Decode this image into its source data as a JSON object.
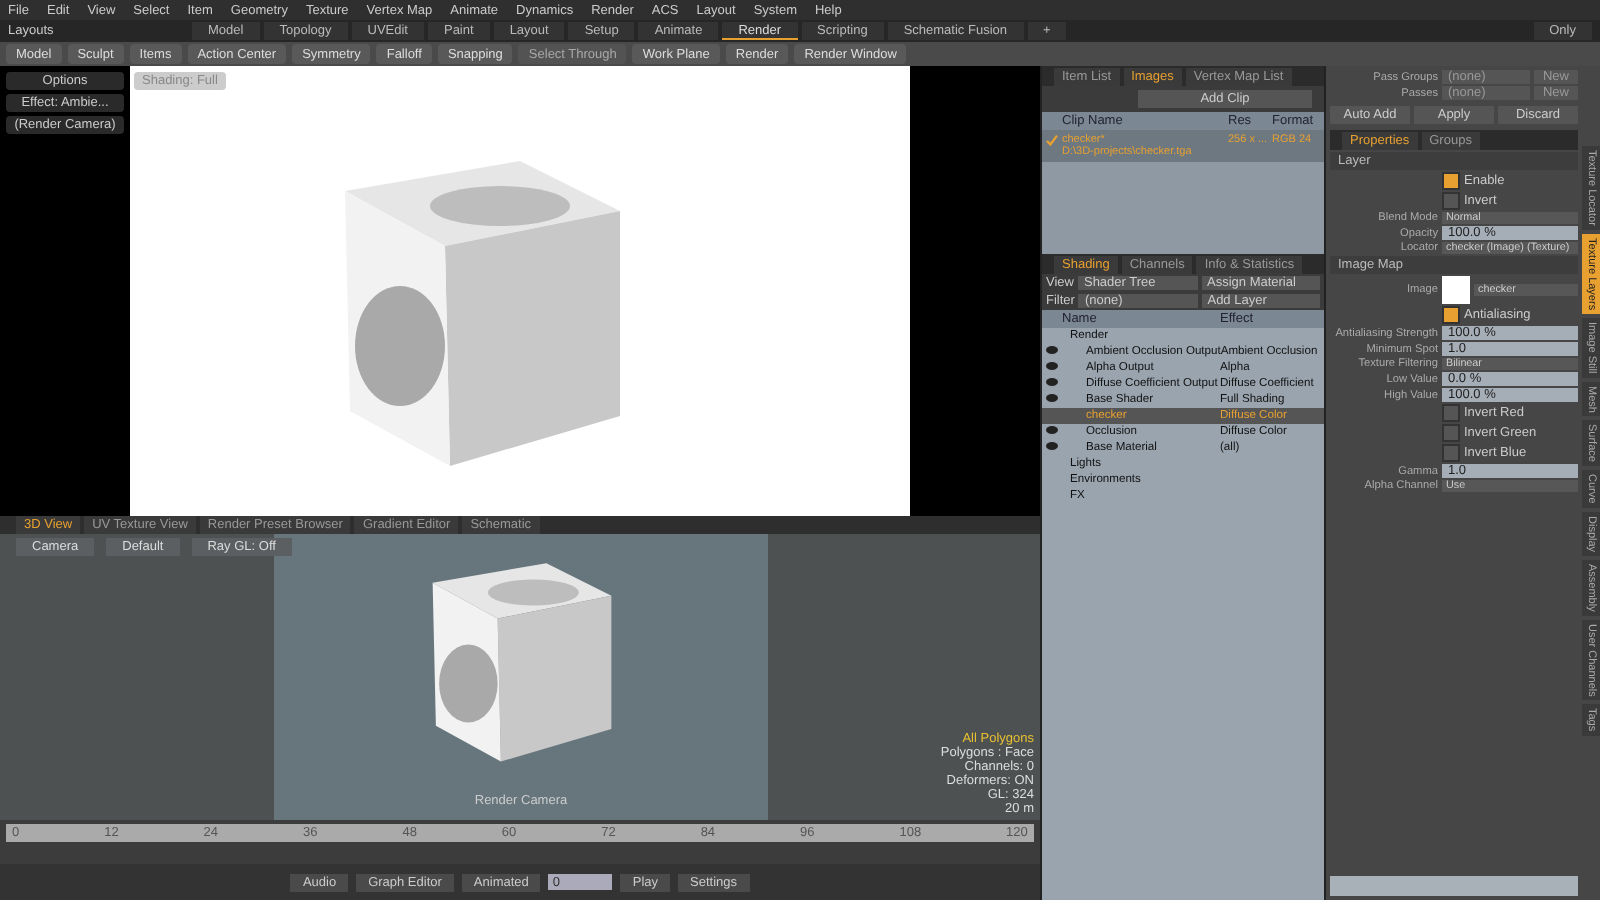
{
  "menu": [
    "File",
    "Edit",
    "View",
    "Select",
    "Item",
    "Geometry",
    "Texture",
    "Vertex Map",
    "Animate",
    "Dynamics",
    "Render",
    "ACS",
    "Layout",
    "System",
    "Help"
  ],
  "layouts_label": "Layouts",
  "layout_tabs": [
    {
      "label": "Model",
      "selected": false
    },
    {
      "label": "Topology",
      "selected": false
    },
    {
      "label": "UVEdit",
      "selected": false
    },
    {
      "label": "Paint",
      "selected": false
    },
    {
      "label": "Layout",
      "selected": false
    },
    {
      "label": "Setup",
      "selected": false
    },
    {
      "label": "Animate",
      "selected": false
    },
    {
      "label": "Render",
      "selected": true
    },
    {
      "label": "Scripting",
      "selected": false
    },
    {
      "label": "Schematic Fusion",
      "selected": false
    }
  ],
  "add_tab": "+",
  "only_toggle": "Only",
  "toolbar": [
    {
      "label": "Model",
      "disabled": false
    },
    {
      "label": "Sculpt",
      "disabled": false
    },
    {
      "label": "Items",
      "disabled": false
    },
    {
      "label": "Action Center",
      "disabled": false
    },
    {
      "label": "Symmetry",
      "disabled": false
    },
    {
      "label": "Falloff",
      "disabled": false
    },
    {
      "label": "Snapping",
      "disabled": false
    },
    {
      "label": "Select Through",
      "disabled": true
    },
    {
      "label": "Work Plane",
      "disabled": false
    },
    {
      "label": "Render",
      "disabled": false
    },
    {
      "label": "Render Window",
      "disabled": false
    }
  ],
  "render_view": {
    "options": "Options",
    "effect": "Effect: Ambie...",
    "camera": "(Render Camera)",
    "shading": "Shading: Full"
  },
  "clip_panel": {
    "tabs": [
      {
        "label": "Item List",
        "selected": false
      },
      {
        "label": "Images",
        "selected": true
      },
      {
        "label": "Vertex Map List",
        "selected": false
      }
    ],
    "add_clip": "Add Clip",
    "columns": [
      "Clip Name",
      "Res",
      "Format"
    ],
    "clips": [
      {
        "name": "checker*",
        "path": "D:\\3D-projects\\checker.tga",
        "res": "256 x ...",
        "format": "RGB 24",
        "checked": true
      }
    ]
  },
  "shading_panel": {
    "tabs": [
      {
        "label": "Shading",
        "selected": true
      },
      {
        "label": "Channels",
        "selected": false
      },
      {
        "label": "Info & Statistics",
        "selected": false
      }
    ],
    "view_label": "View",
    "view_value": "Shader Tree",
    "assign": "Assign Material",
    "filter_label": "Filter",
    "filter_value": "(none)",
    "add_layer": "Add Layer",
    "columns": [
      "Name",
      "Effect"
    ],
    "tree": [
      {
        "label": "Render",
        "visible": false,
        "selected": false,
        "children": [
          {
            "label": "Ambient Occlusion Output",
            "effect": "Ambient Occlusion",
            "visible": true,
            "selected": false
          },
          {
            "label": "Alpha Output",
            "effect": "Alpha",
            "visible": true,
            "selected": false
          },
          {
            "label": "Diffuse Coefficient Output",
            "effect": "Diffuse Coefficient",
            "visible": true,
            "selected": false
          },
          {
            "label": "Base Shader",
            "effect": "Full Shading",
            "visible": true,
            "selected": false
          },
          {
            "label": "checker",
            "effect": "Diffuse Color",
            "visible": false,
            "selected": true
          },
          {
            "label": "Occlusion",
            "effect": "Diffuse Color",
            "visible": true,
            "selected": false
          },
          {
            "label": "Base Material",
            "effect": "(all)",
            "visible": true,
            "selected": false
          }
        ]
      },
      {
        "label": "Lights",
        "visible": false,
        "selected": false
      },
      {
        "label": "Environments",
        "visible": false,
        "selected": false
      },
      {
        "label": "FX",
        "visible": false,
        "selected": false
      }
    ]
  },
  "properties": {
    "pass_groups_label": "Pass Groups",
    "pass_groups_value": "(none)",
    "passes_label": "Passes",
    "passes_value": "(none)",
    "pass_groups_new": "New",
    "passes_new": "New",
    "actions": [
      "Auto Add",
      "Apply",
      "Discard"
    ],
    "tabs": [
      {
        "label": "Properties",
        "selected": true
      },
      {
        "label": "Groups",
        "selected": false
      }
    ],
    "rows": [
      {
        "kind": "section",
        "label": "Layer"
      },
      {
        "kind": "checkbox",
        "label": "Enable",
        "checked": true
      },
      {
        "kind": "checkbox",
        "label": "Invert",
        "checked": false
      },
      {
        "kind": "dropdown",
        "label": "Blend Mode",
        "value": "Normal"
      },
      {
        "kind": "number",
        "label": "Opacity",
        "value": "100.0 %"
      },
      {
        "kind": "dropdown",
        "label": "Locator",
        "value": "checker (Image) (Texture)"
      },
      {
        "kind": "section",
        "label": "Image Map"
      },
      {
        "kind": "image",
        "label": "Image",
        "value": "checker"
      },
      {
        "kind": "checkbox",
        "label": "Antialiasing",
        "checked": true
      },
      {
        "kind": "number",
        "label": "Antialiasing Strength",
        "value": "100.0 %"
      },
      {
        "kind": "number",
        "label": "Minimum Spot",
        "value": "1.0"
      },
      {
        "kind": "dropdown",
        "label": "Texture Filtering",
        "value": "Bilinear"
      },
      {
        "kind": "number",
        "label": "Low Value",
        "value": "0.0 %"
      },
      {
        "kind": "number",
        "label": "High Value",
        "value": "100.0 %"
      },
      {
        "kind": "checkbox",
        "label": "Invert Red",
        "checked": false
      },
      {
        "kind": "checkbox",
        "label": "Invert Green",
        "checked": false
      },
      {
        "kind": "checkbox",
        "label": "Invert Blue",
        "checked": false
      },
      {
        "kind": "number",
        "label": "Gamma",
        "value": "1.0"
      },
      {
        "kind": "dropdown",
        "label": "Alpha Channel",
        "value": "Use"
      }
    ],
    "side_tabs": [
      {
        "label": "Texture Locator",
        "selected": false
      },
      {
        "label": "Texture Layers",
        "selected": true
      },
      {
        "label": "Image Still",
        "selected": false
      },
      {
        "label": "Mesh",
        "selected": false
      },
      {
        "label": "Surface",
        "selected": false
      },
      {
        "label": "Curve",
        "selected": false
      },
      {
        "label": "Display",
        "selected": false
      },
      {
        "label": "Assembly",
        "selected": false
      },
      {
        "label": "User Channels",
        "selected": false
      },
      {
        "label": "Tags",
        "selected": false
      }
    ]
  },
  "viewport": {
    "tabs": [
      {
        "label": "3D View",
        "selected": true
      },
      {
        "label": "UV Texture View",
        "selected": false
      },
      {
        "label": "Render Preset Browser",
        "selected": false
      },
      {
        "label": "Gradient Editor",
        "selected": false
      },
      {
        "label": "Schematic",
        "selected": false
      }
    ],
    "buttons": [
      "Camera",
      "Default",
      "Ray GL: Off"
    ],
    "camera_label": "Render Camera",
    "info": [
      "All Polygons",
      "Polygons : Face",
      "Channels: 0",
      "Deformers: ON",
      "GL: 324",
      "20 m"
    ]
  },
  "timeline": {
    "ticks": [
      "0",
      "12",
      "24",
      "36",
      "48",
      "60",
      "72",
      "84",
      "96",
      "108",
      "120"
    ]
  },
  "transport": {
    "audio": "Audio",
    "graph_editor": "Graph Editor",
    "mode": "Animated",
    "frame": "0",
    "play": "Play",
    "settings": "Settings"
  }
}
